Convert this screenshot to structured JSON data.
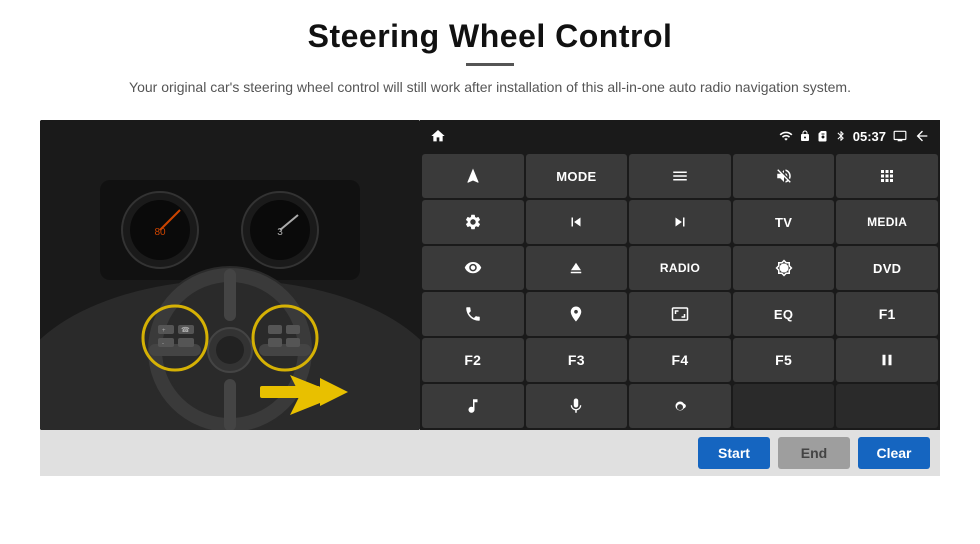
{
  "header": {
    "title": "Steering Wheel Control",
    "divider": true,
    "subtitle": "Your original car's steering wheel control will still work after installation of this all-in-one auto radio navigation system."
  },
  "status_bar": {
    "time": "05:37",
    "icons": [
      "wifi",
      "lock",
      "sim",
      "bluetooth",
      "battery",
      "screen",
      "back"
    ]
  },
  "button_grid": [
    {
      "id": "btn-nav",
      "type": "icon",
      "icon": "navigate"
    },
    {
      "id": "btn-mode",
      "type": "text",
      "label": "MODE"
    },
    {
      "id": "btn-list",
      "type": "icon",
      "icon": "list"
    },
    {
      "id": "btn-mute",
      "type": "icon",
      "icon": "mute"
    },
    {
      "id": "btn-apps",
      "type": "icon",
      "icon": "apps"
    },
    {
      "id": "btn-settings",
      "type": "icon",
      "icon": "settings"
    },
    {
      "id": "btn-prev",
      "type": "icon",
      "icon": "prev"
    },
    {
      "id": "btn-next",
      "type": "icon",
      "icon": "next"
    },
    {
      "id": "btn-tv",
      "type": "text",
      "label": "TV"
    },
    {
      "id": "btn-media",
      "type": "text",
      "label": "MEDIA"
    },
    {
      "id": "btn-360",
      "type": "icon",
      "icon": "camera360"
    },
    {
      "id": "btn-eject",
      "type": "icon",
      "icon": "eject"
    },
    {
      "id": "btn-radio",
      "type": "text",
      "label": "RADIO"
    },
    {
      "id": "btn-brightness",
      "type": "icon",
      "icon": "brightness"
    },
    {
      "id": "btn-dvd",
      "type": "text",
      "label": "DVD"
    },
    {
      "id": "btn-phone",
      "type": "icon",
      "icon": "phone"
    },
    {
      "id": "btn-nav2",
      "type": "icon",
      "icon": "navigation2"
    },
    {
      "id": "btn-screen",
      "type": "icon",
      "icon": "screen"
    },
    {
      "id": "btn-eq",
      "type": "text",
      "label": "EQ"
    },
    {
      "id": "btn-f1",
      "type": "text",
      "label": "F1"
    },
    {
      "id": "btn-f2",
      "type": "text",
      "label": "F2"
    },
    {
      "id": "btn-f3",
      "type": "text",
      "label": "F3"
    },
    {
      "id": "btn-f4",
      "type": "text",
      "label": "F4"
    },
    {
      "id": "btn-f5",
      "type": "text",
      "label": "F5"
    },
    {
      "id": "btn-playpause",
      "type": "icon",
      "icon": "playpause"
    },
    {
      "id": "btn-music",
      "type": "icon",
      "icon": "music"
    },
    {
      "id": "btn-mic",
      "type": "icon",
      "icon": "mic"
    },
    {
      "id": "btn-vol",
      "type": "icon",
      "icon": "volume_call"
    },
    {
      "id": "btn-empty1",
      "type": "empty"
    },
    {
      "id": "btn-empty2",
      "type": "empty"
    }
  ],
  "action_bar": {
    "start_label": "Start",
    "end_label": "End",
    "clear_label": "Clear"
  }
}
